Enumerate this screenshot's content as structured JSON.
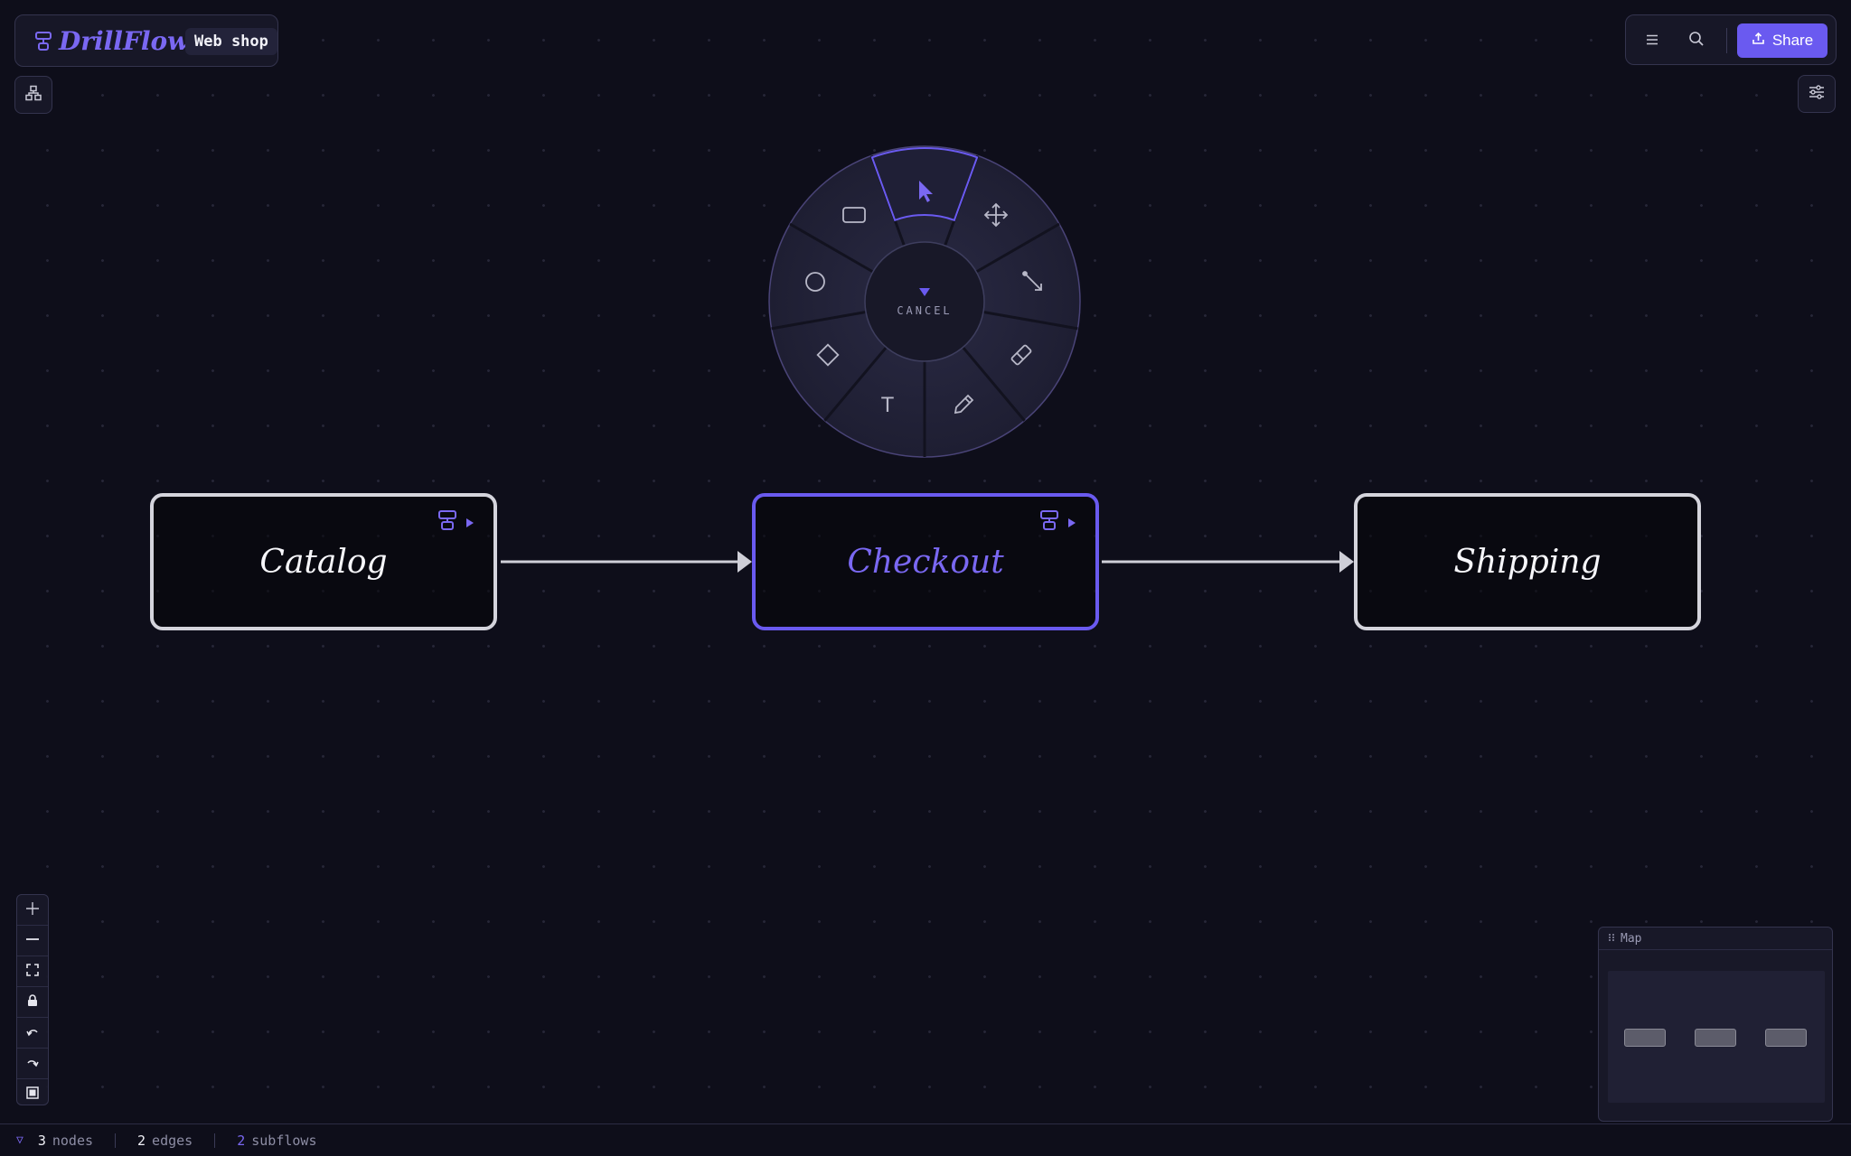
{
  "brand": {
    "app_name": "DrillFlow",
    "project_name": "Web shop"
  },
  "toolbar": {
    "share_label": "Share",
    "menu_icon": "hamburger-icon",
    "search_icon": "search-icon",
    "share_icon": "upload-icon"
  },
  "left_tools": {
    "hierarchy_icon": "hierarchy-icon"
  },
  "right_tools": {
    "settings_icon": "sliders-icon"
  },
  "radial_menu": {
    "center_label": "CANCEL",
    "active_tool": "select",
    "tools": [
      {
        "id": "select",
        "icon": "cursor-icon"
      },
      {
        "id": "move",
        "icon": "move-icon"
      },
      {
        "id": "connector",
        "icon": "arrow-connector-icon"
      },
      {
        "id": "eraser",
        "icon": "eraser-icon"
      },
      {
        "id": "pen",
        "icon": "pencil-icon"
      },
      {
        "id": "text",
        "icon": "text-icon",
        "glyph": "T"
      },
      {
        "id": "diamond",
        "icon": "diamond-icon"
      },
      {
        "id": "circle",
        "icon": "circle-icon"
      },
      {
        "id": "rectangle",
        "icon": "rectangle-icon"
      }
    ]
  },
  "nodes": [
    {
      "id": "catalog",
      "label": "Catalog",
      "has_subflow": true,
      "selected": false
    },
    {
      "id": "checkout",
      "label": "Checkout",
      "has_subflow": true,
      "selected": true
    },
    {
      "id": "shipping",
      "label": "Shipping",
      "has_subflow": false,
      "selected": false
    }
  ],
  "edges": [
    {
      "from": "catalog",
      "to": "checkout"
    },
    {
      "from": "checkout",
      "to": "shipping"
    }
  ],
  "zoom_controls": [
    "zoom-in-icon",
    "zoom-out-icon",
    "fit-view-icon",
    "lock-icon",
    "undo-icon",
    "redo-icon",
    "frame-icon"
  ],
  "minimap": {
    "title": "Map"
  },
  "status": {
    "nodes_count": "3",
    "nodes_label": "nodes",
    "edges_count": "2",
    "edges_label": "edges",
    "subflows_count": "2",
    "subflows_label": "subflows"
  },
  "colors": {
    "accent": "#6a5af0",
    "accent_text": "#7a68f2",
    "background": "#0e0e1a",
    "node_border": "#d4d4dc",
    "panel": "#181828"
  }
}
